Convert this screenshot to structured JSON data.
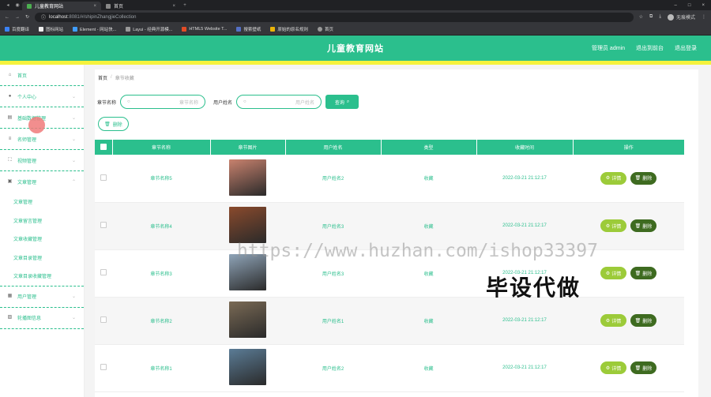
{
  "browser": {
    "tabs": [
      {
        "title": "儿童教育网站",
        "active": true
      },
      {
        "title": "首页",
        "active": false
      }
    ],
    "url_host": "localhost",
    "url_path": ":8081/#/shipinZhangjieCollection",
    "profile_label": "无痕模式",
    "bookmarks": [
      "百度翻译",
      "图标网站",
      "Element - 网站快...",
      "Layui - 经典开源模...",
      "HTML5 Website T...",
      "搜索壁纸",
      "原始的原名规则",
      "首页"
    ]
  },
  "header": {
    "site_title": "儿童教育网站",
    "admin_label": "管理员 admin",
    "backend_link": "退出到前台",
    "logout_link": "退出登录"
  },
  "sidebar": {
    "items": [
      {
        "label": "首页",
        "icon": "home-icon"
      },
      {
        "label": "个人中心",
        "icon": "user-icon"
      },
      {
        "label": "基础数据管理",
        "icon": "database-icon"
      },
      {
        "label": "名师管理",
        "icon": "list-icon"
      },
      {
        "label": "视频管理",
        "icon": "video-icon"
      },
      {
        "label": "文章管理",
        "icon": "doc-icon"
      }
    ],
    "submenu": [
      "文章管理",
      "文章留言管理",
      "文章收藏管理",
      "文章目录管理",
      "文章目录收藏管理"
    ],
    "bottom_items": [
      {
        "label": "用户管理",
        "icon": "users-icon"
      },
      {
        "label": "轮播图信息",
        "icon": "image-icon"
      }
    ]
  },
  "breadcrumb": {
    "home": "首页",
    "sep": "/",
    "current": "章节收藏"
  },
  "search": {
    "label1": "章节名称",
    "placeholder1": "章节名称",
    "label2": "用户姓名",
    "placeholder2": "用户姓名",
    "query_button": "查询",
    "delete_button": "删除"
  },
  "table": {
    "headers": [
      "章节名称",
      "章节图片",
      "用户姓名",
      "类型",
      "收藏时间",
      "操作"
    ],
    "detail_label": "详情",
    "delete_label": "删除",
    "rows": [
      {
        "name": "章节名称5",
        "user": "用户姓名2",
        "type": "收藏",
        "time": "2022-03-21 21:12:17",
        "thumb_color": "#c9826e"
      },
      {
        "name": "章节名称4",
        "user": "用户姓名3",
        "type": "收藏",
        "time": "2022-03-21 21:12:17",
        "thumb_color": "#8a4a2c"
      },
      {
        "name": "章节名称3",
        "user": "用户姓名3",
        "type": "收藏",
        "time": "2022-03-21 21:12:17",
        "thumb_color": "#8fa4b8"
      },
      {
        "name": "章节名称2",
        "user": "用户姓名1",
        "type": "收藏",
        "time": "2022-03-21 21:12:17",
        "thumb_color": "#7a6a55"
      },
      {
        "name": "章节名称1",
        "user": "用户姓名2",
        "type": "收藏",
        "time": "2022-03-21 21:12:17",
        "thumb_color": "#5b7c96"
      }
    ]
  },
  "watermark": {
    "url": "https://www.huzhan.com/ishop33397",
    "text": "毕设代做"
  }
}
